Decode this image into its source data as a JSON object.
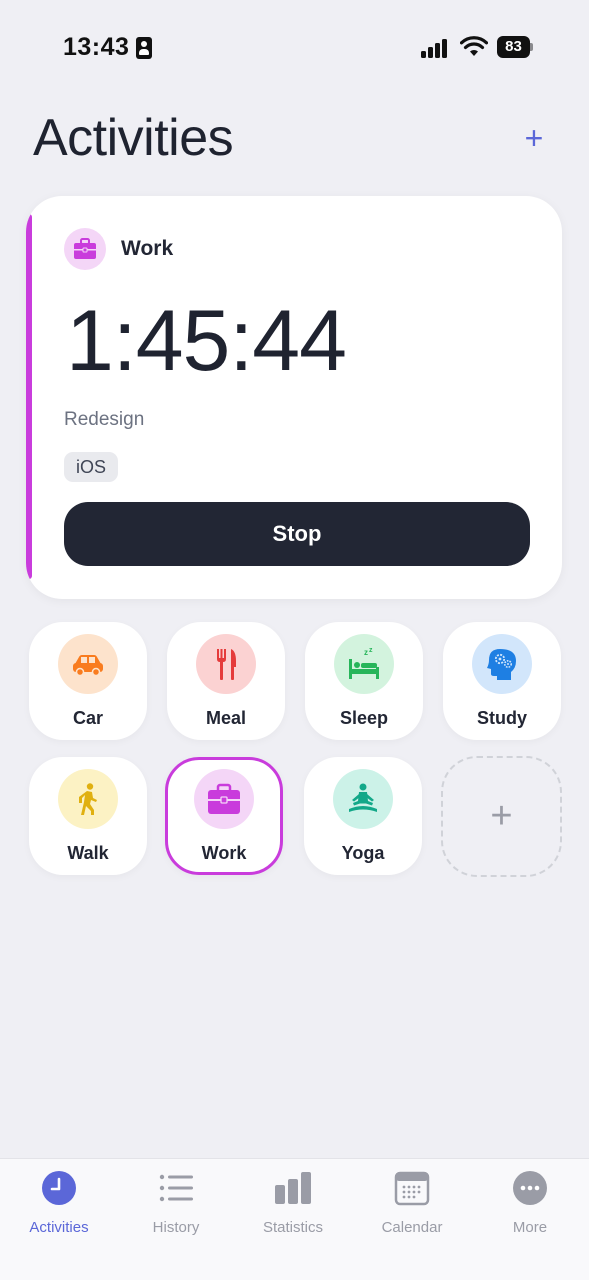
{
  "status_bar": {
    "time": "13:43",
    "battery": "83"
  },
  "header": {
    "title": "Activities",
    "add_label": "+"
  },
  "timer": {
    "activity": "Work",
    "elapsed": "1:45:44",
    "note": "Redesign",
    "tag": "iOS",
    "stop_label": "Stop",
    "accent_color": "#c93cdc"
  },
  "activities": [
    {
      "label": "Car",
      "icon": "car-icon",
      "color": "#f97c1f",
      "bg": "#fde3cc"
    },
    {
      "label": "Meal",
      "icon": "utensils-icon",
      "color": "#e53b3b",
      "bg": "#fbd2d2"
    },
    {
      "label": "Sleep",
      "icon": "bed-icon",
      "color": "#27b55a",
      "bg": "#d3f3de"
    },
    {
      "label": "Study",
      "icon": "brain-icon",
      "color": "#1e7fe3",
      "bg": "#d2e6fb"
    },
    {
      "label": "Walk",
      "icon": "walking-icon",
      "color": "#e0b010",
      "bg": "#fcf2c4"
    },
    {
      "label": "Work",
      "icon": "briefcase-icon",
      "color": "#c93cdc",
      "bg": "#f4d6f7",
      "selected": true
    },
    {
      "label": "Yoga",
      "icon": "yoga-icon",
      "color": "#13a889",
      "bg": "#ccf2e8"
    }
  ],
  "add_activity_label": "+",
  "tabs": [
    {
      "label": "Activities",
      "icon": "clock-icon",
      "active": true
    },
    {
      "label": "History",
      "icon": "list-icon"
    },
    {
      "label": "Statistics",
      "icon": "bar-chart-icon"
    },
    {
      "label": "Calendar",
      "icon": "calendar-icon"
    },
    {
      "label": "More",
      "icon": "more-icon"
    }
  ],
  "colors": {
    "accent": "#5b67d8",
    "dark": "#222634",
    "background": "#efeff4"
  }
}
